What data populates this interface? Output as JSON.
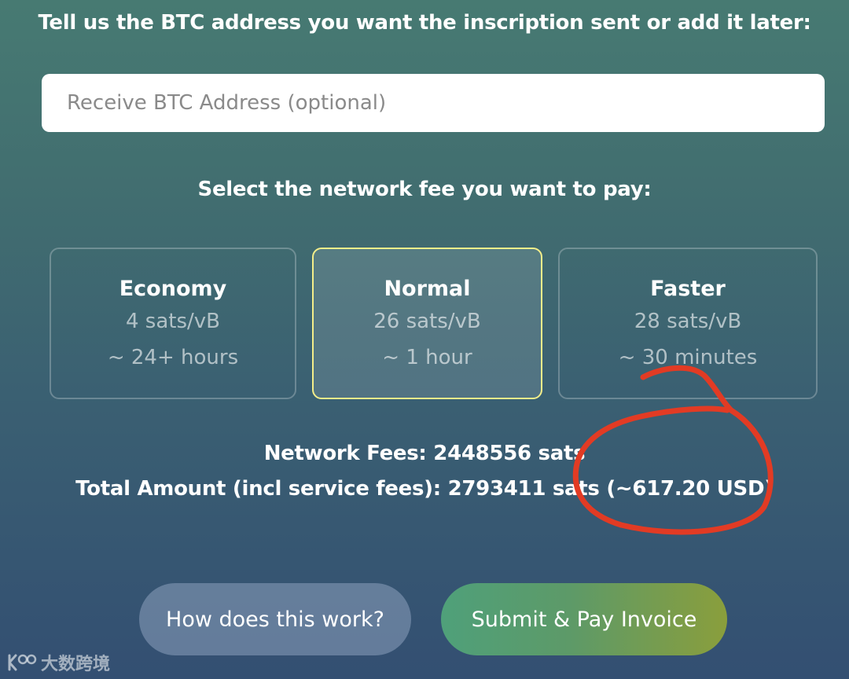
{
  "address_section": {
    "title": "Tell us the BTC address you want the inscription sent or add it later:",
    "input_value": "",
    "input_placeholder": "Receive BTC Address (optional)"
  },
  "fee_section": {
    "title": "Select the network fee you want to pay:",
    "selected": "Normal",
    "options": [
      {
        "name": "Economy",
        "rate": "4 sats/vB",
        "time": "~ 24+ hours"
      },
      {
        "name": "Normal",
        "rate": "26 sats/vB",
        "time": "~ 1 hour"
      },
      {
        "name": "Faster",
        "rate": "28 sats/vB",
        "time": "~ 30 minutes"
      }
    ],
    "selected_border_color": "#f4ee8a"
  },
  "summary": {
    "network_fees": "Network Fees: 2448556 sats",
    "total_amount": "Total Amount (incl service fees): 2793411 sats (~617.20 USD)"
  },
  "buttons": {
    "how_label": "How does this work?",
    "submit_label": "Submit & Pay Invoice"
  },
  "annotation": {
    "color": "#e23b24",
    "icon": "hand-drawn-circle"
  },
  "watermark": {
    "text": "大数跨境",
    "icon": "brand-logo-icon"
  }
}
